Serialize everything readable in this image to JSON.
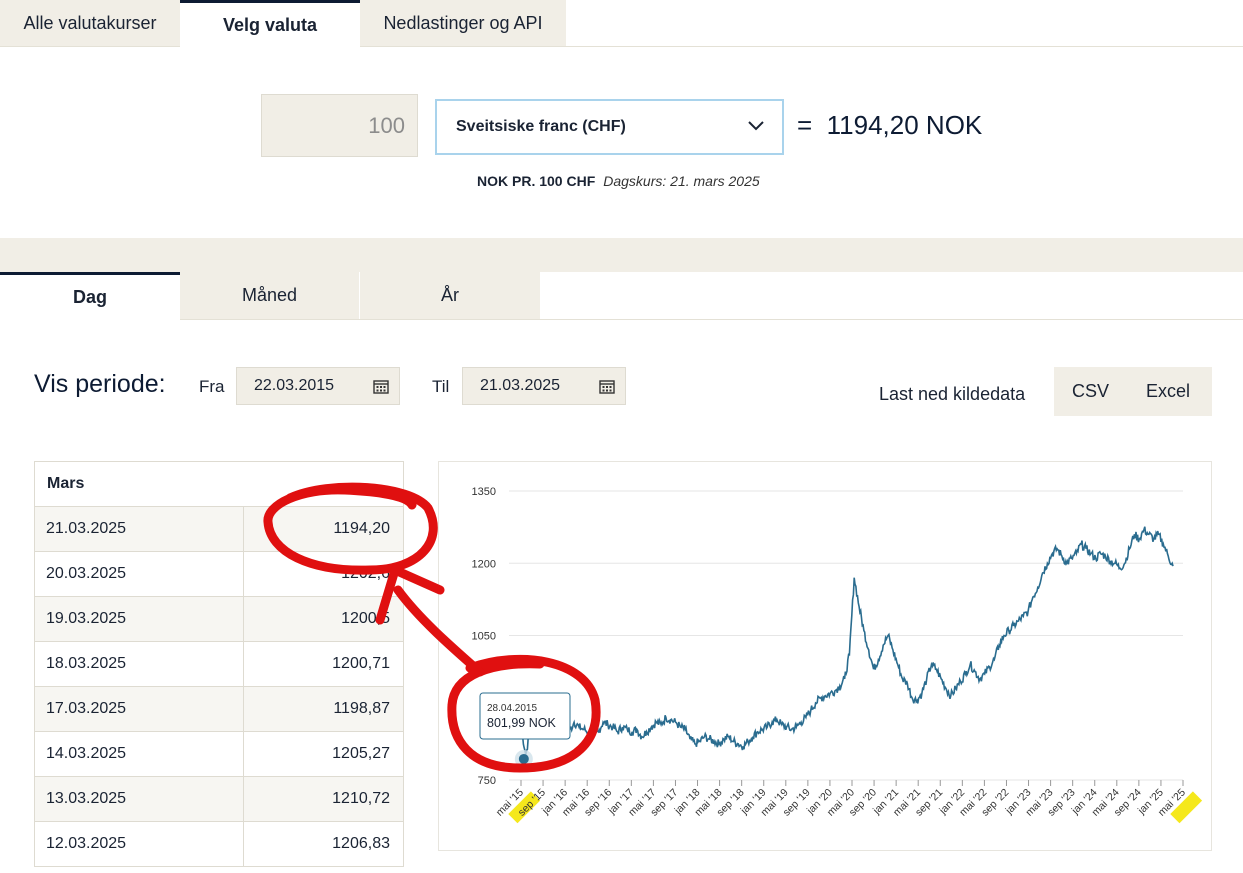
{
  "top_tabs": [
    {
      "label": "Alle valutakurser"
    },
    {
      "label": "Velg valuta"
    },
    {
      "label": "Nedlastinger og API"
    }
  ],
  "converter": {
    "amount_placeholder": "100",
    "currency": "Sveitsiske franc (CHF)",
    "equals": "=",
    "result": "1194,20 NOK",
    "rate_label": "NOK PR. 100 CHF",
    "rate_date": "Dagskurs: 21. mars 2025"
  },
  "period_tabs": [
    {
      "label": "Dag"
    },
    {
      "label": "Måned"
    },
    {
      "label": "År"
    }
  ],
  "period": {
    "title": "Vis periode:",
    "from_label": "Fra",
    "from_value": "22.03.2015",
    "to_label": "Til",
    "to_value": "21.03.2025",
    "download_label": "Last ned kildedata",
    "csv_label": "CSV",
    "excel_label": "Excel"
  },
  "table": {
    "month": "Mars",
    "rows": [
      {
        "date": "21.03.2025",
        "value": "1194,20"
      },
      {
        "date": "20.03.2025",
        "value": "1202,6"
      },
      {
        "date": "19.03.2025",
        "value": "1200,5"
      },
      {
        "date": "18.03.2025",
        "value": "1200,71"
      },
      {
        "date": "17.03.2025",
        "value": "1198,87"
      },
      {
        "date": "14.03.2025",
        "value": "1205,27"
      },
      {
        "date": "13.03.2025",
        "value": "1210,72"
      },
      {
        "date": "12.03.2025",
        "value": "1206,83"
      }
    ]
  },
  "chart_data": {
    "type": "line",
    "ylim": [
      750,
      1350
    ],
    "yticks": [
      "1350",
      "1200",
      "1050",
      "750"
    ],
    "xticks": [
      "mai '15",
      "sep '15",
      "jan '16",
      "mai '16",
      "sep '16",
      "jan '17",
      "mai '17",
      "sep '17",
      "jan '18",
      "mai '18",
      "sep '18",
      "jan '19",
      "mai '19",
      "sep '19",
      "jan '20",
      "mai '20",
      "sep '20",
      "jan '21",
      "mai '21",
      "sep '21",
      "jan '22",
      "mai '22",
      "sep '22",
      "jan '23",
      "mai '23",
      "sep '23",
      "jan '24",
      "mai '24",
      "sep '24",
      "jan '25",
      "mai '25"
    ],
    "highlighted_ticks": [
      "mai '15",
      "mai '25"
    ],
    "series": [
      {
        "points": [
          [
            0,
            860
          ],
          [
            1,
            802
          ],
          [
            2,
            860
          ],
          [
            3,
            880
          ],
          [
            4,
            850
          ],
          [
            5,
            860
          ],
          [
            6,
            880
          ],
          [
            7,
            870
          ],
          [
            8,
            850
          ],
          [
            9,
            845
          ],
          [
            10,
            850
          ],
          [
            11,
            870
          ],
          [
            12,
            860
          ],
          [
            13,
            855
          ],
          [
            14,
            850
          ],
          [
            15,
            845
          ],
          [
            16,
            850
          ],
          [
            17,
            870
          ],
          [
            18,
            865
          ],
          [
            19,
            860
          ],
          [
            20,
            850
          ],
          [
            21,
            860
          ],
          [
            22,
            855
          ],
          [
            23,
            850
          ],
          [
            24,
            855
          ],
          [
            25,
            840
          ],
          [
            26,
            850
          ],
          [
            27,
            860
          ],
          [
            28,
            870
          ],
          [
            29,
            865
          ],
          [
            30,
            880
          ],
          [
            31,
            875
          ],
          [
            32,
            870
          ],
          [
            33,
            860
          ],
          [
            34,
            855
          ],
          [
            35,
            835
          ],
          [
            36,
            825
          ],
          [
            37,
            830
          ],
          [
            38,
            840
          ],
          [
            39,
            835
          ],
          [
            40,
            830
          ],
          [
            41,
            825
          ],
          [
            42,
            835
          ],
          [
            43,
            840
          ],
          [
            44,
            830
          ],
          [
            45,
            825
          ],
          [
            46,
            820
          ],
          [
            47,
            830
          ],
          [
            48,
            840
          ],
          [
            49,
            850
          ],
          [
            50,
            855
          ],
          [
            51,
            860
          ],
          [
            52,
            870
          ],
          [
            53,
            875
          ],
          [
            54,
            865
          ],
          [
            55,
            860
          ],
          [
            56,
            855
          ],
          [
            57,
            860
          ],
          [
            58,
            870
          ],
          [
            59,
            880
          ],
          [
            60,
            895
          ],
          [
            61,
            910
          ],
          [
            62,
            920
          ],
          [
            63,
            925
          ],
          [
            64,
            930
          ],
          [
            65,
            935
          ],
          [
            66,
            945
          ],
          [
            67,
            960
          ],
          [
            68,
            1010
          ],
          [
            69,
            1170
          ],
          [
            70,
            1110
          ],
          [
            71,
            1060
          ],
          [
            72,
            1020
          ],
          [
            73,
            980
          ],
          [
            74,
            1000
          ],
          [
            75,
            1030
          ],
          [
            76,
            1050
          ],
          [
            77,
            1020
          ],
          [
            78,
            990
          ],
          [
            79,
            960
          ],
          [
            80,
            950
          ],
          [
            81,
            920
          ],
          [
            82,
            915
          ],
          [
            83,
            930
          ],
          [
            84,
            960
          ],
          [
            85,
            990
          ],
          [
            86,
            980
          ],
          [
            87,
            960
          ],
          [
            88,
            940
          ],
          [
            89,
            925
          ],
          [
            90,
            940
          ],
          [
            91,
            955
          ],
          [
            92,
            970
          ],
          [
            93,
            990
          ],
          [
            94,
            975
          ],
          [
            95,
            960
          ],
          [
            96,
            970
          ],
          [
            97,
            985
          ],
          [
            98,
            1000
          ],
          [
            99,
            1030
          ],
          [
            100,
            1050
          ],
          [
            101,
            1060
          ],
          [
            102,
            1070
          ],
          [
            103,
            1080
          ],
          [
            104,
            1090
          ],
          [
            105,
            1100
          ],
          [
            106,
            1130
          ],
          [
            107,
            1150
          ],
          [
            108,
            1180
          ],
          [
            109,
            1200
          ],
          [
            110,
            1220
          ],
          [
            111,
            1230
          ],
          [
            112,
            1215
          ],
          [
            113,
            1200
          ],
          [
            114,
            1210
          ],
          [
            115,
            1220
          ],
          [
            116,
            1240
          ],
          [
            117,
            1230
          ],
          [
            118,
            1220
          ],
          [
            119,
            1210
          ],
          [
            120,
            1220
          ],
          [
            121,
            1215
          ],
          [
            122,
            1205
          ],
          [
            123,
            1200
          ],
          [
            124,
            1190
          ],
          [
            125,
            1200
          ],
          [
            126,
            1230
          ],
          [
            127,
            1260
          ],
          [
            128,
            1250
          ],
          [
            129,
            1270
          ],
          [
            130,
            1260
          ],
          [
            131,
            1250
          ],
          [
            132,
            1260
          ],
          [
            133,
            1240
          ],
          [
            134,
            1215
          ],
          [
            135,
            1194
          ]
        ]
      }
    ],
    "tooltip": {
      "date": "28.04.2015",
      "value": "801,99 NOK"
    }
  }
}
